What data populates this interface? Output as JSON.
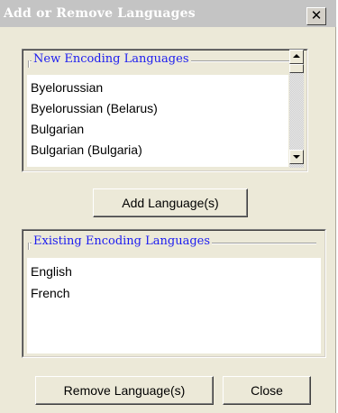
{
  "window": {
    "title": "Add or Remove Languages",
    "close_glyph": "✕"
  },
  "new_group": {
    "label": "New Encoding Languages",
    "items": [
      "Byelorussian",
      "Byelorussian (Belarus)",
      "Bulgarian",
      "Bulgarian (Bulgaria)"
    ]
  },
  "add_button_label": "Add Language(s)",
  "existing_group": {
    "label": "Existing Encoding Languages",
    "items": [
      "English",
      "French"
    ]
  },
  "remove_button_label": "Remove Language(s)",
  "close_button_label": "Close",
  "icons": {
    "scroll_up": "scroll-up-arrow-icon",
    "scroll_down": "scroll-down-arrow-icon",
    "close": "close-icon"
  },
  "colors": {
    "group_label": "#1c1cf0",
    "dialog_bg": "#ece9d8",
    "title_bg": "#c4c4c4"
  }
}
